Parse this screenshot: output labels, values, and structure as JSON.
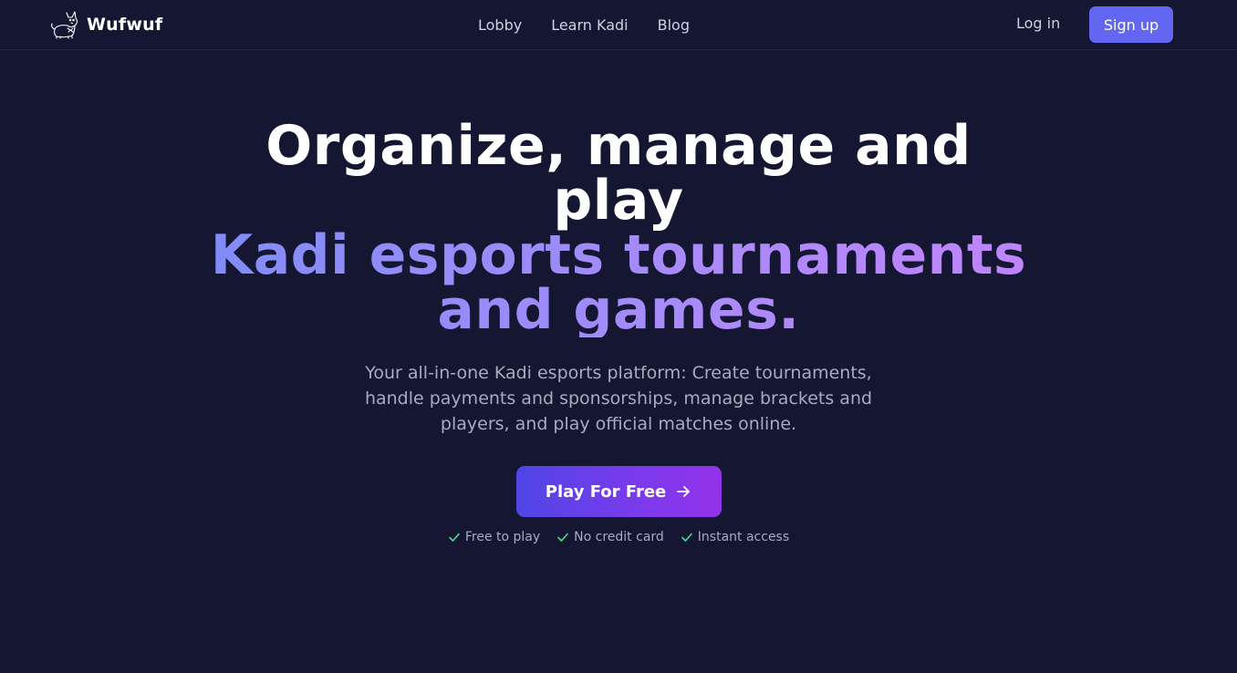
{
  "brand": {
    "name": "Wufwuf",
    "logo_icon": "dog-logo-icon"
  },
  "nav": {
    "items": [
      {
        "label": "Lobby"
      },
      {
        "label": "Learn Kadi"
      },
      {
        "label": "Blog"
      }
    ]
  },
  "auth": {
    "login_label": "Log in",
    "signup_label": "Sign up"
  },
  "hero": {
    "headline_line1": "Organize, manage and play",
    "headline_line2": "Kadi esports tournaments and games.",
    "subtitle": "Your all-in-one Kadi esports platform: Create tournaments, handle payments and sponsorships, manage brackets and players, and play official matches online.",
    "cta_label": "Play For Free",
    "cta_icon": "arrow-right-icon",
    "perks": [
      {
        "label": "Free to play",
        "icon": "check-icon"
      },
      {
        "label": "No credit card",
        "icon": "check-icon"
      },
      {
        "label": "Instant access",
        "icon": "check-icon"
      }
    ]
  },
  "colors": {
    "background": "#141632",
    "accent": "#6366f1",
    "gradient_start": "#818cf8",
    "gradient_end": "#c084fc",
    "check": "#4ade80"
  }
}
